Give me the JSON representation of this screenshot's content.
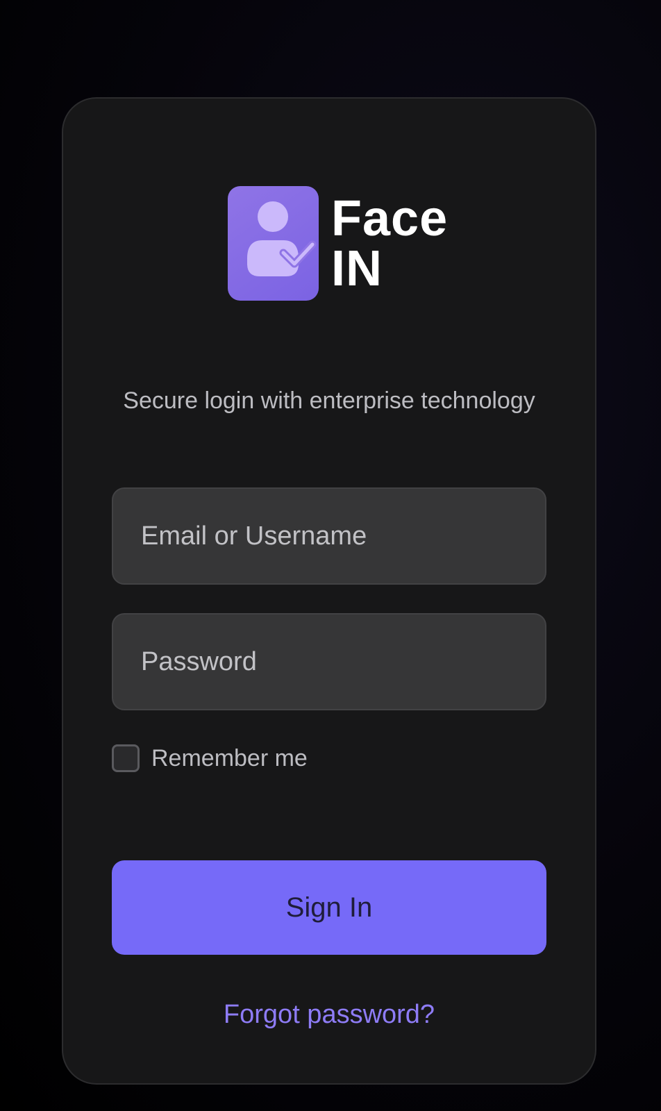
{
  "brand": {
    "name_line1": "Face",
    "name_line2": "IN",
    "logo_icon": "user-check-icon",
    "accent_color": "#766af8"
  },
  "tagline": "Secure login with enterprise technology",
  "form": {
    "email_placeholder": "Email or Username",
    "email_value": "",
    "password_placeholder": "Password",
    "password_value": "",
    "remember_label": "Remember me",
    "remember_checked": false,
    "submit_label": "Sign In",
    "forgot_label": "Forgot password?"
  }
}
